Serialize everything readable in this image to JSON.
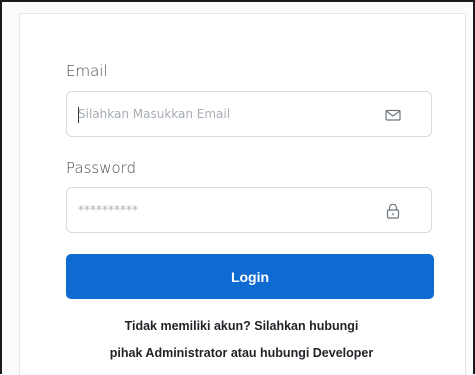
{
  "form": {
    "email_label": "Email",
    "email_placeholder": "Silahkan Masukkan Email",
    "email_value": "",
    "email_icon": "envelope-icon",
    "password_label": "Password",
    "password_value": "**********",
    "password_icon": "lock-icon",
    "login_label": "Login"
  },
  "footer": {
    "line1": "Tidak memiliki akun? Silahkan hubungi",
    "line2": "pihak Administrator atau hubungi Developer"
  },
  "colors": {
    "primary": "#0f6ad2",
    "border": "#d6dbe0",
    "label_text": "#444b52"
  }
}
